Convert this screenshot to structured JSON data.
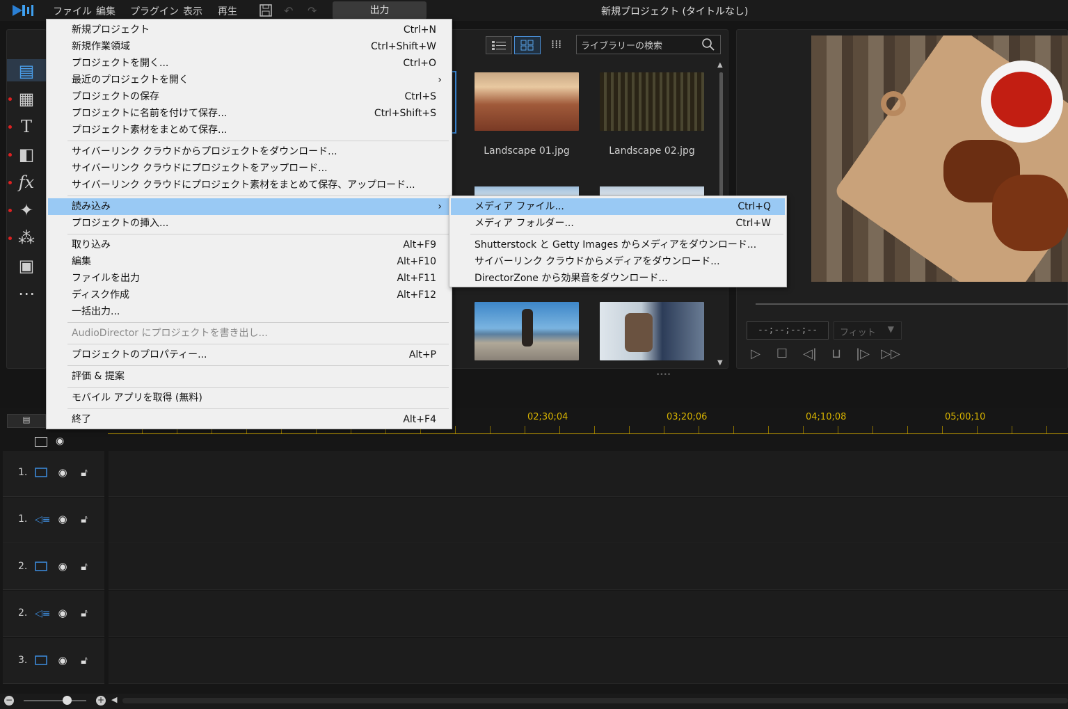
{
  "app": {
    "title": "新規プロジェクト (タイトルなし)"
  },
  "menubar": {
    "items": [
      "ファイル",
      "編集",
      "プラグイン",
      "表示",
      "再生"
    ],
    "output": "出力"
  },
  "library": {
    "search_placeholder": "ライブラリーの検索",
    "items": [
      {
        "label": "Landscape 01.jpg"
      },
      {
        "label": "Landscape 02.jpg"
      }
    ]
  },
  "preview": {
    "timecode": "--;--;--;--",
    "fit": "フィット"
  },
  "timeline": {
    "timecodes": [
      "02;30;04",
      "03;20;06",
      "04;10;08",
      "05;00;10"
    ],
    "tracks": [
      {
        "num": "1.",
        "type": "video"
      },
      {
        "num": "1.",
        "type": "audio"
      },
      {
        "num": "2.",
        "type": "video"
      },
      {
        "num": "2.",
        "type": "audio"
      },
      {
        "num": "3.",
        "type": "video"
      }
    ]
  },
  "file_menu": {
    "items": [
      {
        "label": "新規プロジェクト",
        "shortcut": "Ctrl+N"
      },
      {
        "label": "新規作業領域",
        "shortcut": "Ctrl+Shift+W"
      },
      {
        "label": "プロジェクトを開く...",
        "shortcut": "Ctrl+O"
      },
      {
        "label": "最近のプロジェクトを開く",
        "shortcut": "›"
      },
      {
        "label": "プロジェクトの保存",
        "shortcut": "Ctrl+S"
      },
      {
        "label": "プロジェクトに名前を付けて保存...",
        "shortcut": "Ctrl+Shift+S"
      },
      {
        "label": "プロジェクト素材をまとめて保存...",
        "shortcut": ""
      },
      {
        "label": "サイバーリンク クラウドからプロジェクトをダウンロード...",
        "shortcut": ""
      },
      {
        "label": "サイバーリンク クラウドにプロジェクトをアップロード...",
        "shortcut": ""
      },
      {
        "label": "サイバーリンク クラウドにプロジェクト素材をまとめて保存、アップロード...",
        "shortcut": ""
      },
      {
        "label": "読み込み",
        "shortcut": "›"
      },
      {
        "label": "プロジェクトの挿入...",
        "shortcut": ""
      },
      {
        "label": "取り込み",
        "shortcut": "Alt+F9"
      },
      {
        "label": "編集",
        "shortcut": "Alt+F10"
      },
      {
        "label": "ファイルを出力",
        "shortcut": "Alt+F11"
      },
      {
        "label": "ディスク作成",
        "shortcut": "Alt+F12"
      },
      {
        "label": "一括出力...",
        "shortcut": ""
      },
      {
        "label": "AudioDirector にプロジェクトを書き出し...",
        "shortcut": ""
      },
      {
        "label": "プロジェクトのプロパティー...",
        "shortcut": "Alt+P"
      },
      {
        "label": "評価 & 提案",
        "shortcut": ""
      },
      {
        "label": "モバイル アプリを取得 (無料)",
        "shortcut": ""
      },
      {
        "label": "終了",
        "shortcut": "Alt+F4"
      }
    ]
  },
  "import_submenu": {
    "items": [
      {
        "label": "メディア ファイル...",
        "shortcut": "Ctrl+Q"
      },
      {
        "label": "メディア フォルダー...",
        "shortcut": "Ctrl+W"
      },
      {
        "label": "Shutterstock と Getty Images からメディアをダウンロード...",
        "shortcut": ""
      },
      {
        "label": "サイバーリンク クラウドからメディアをダウンロード...",
        "shortcut": ""
      },
      {
        "label": "DirectorZone から効果音をダウンロード...",
        "shortcut": ""
      }
    ]
  }
}
